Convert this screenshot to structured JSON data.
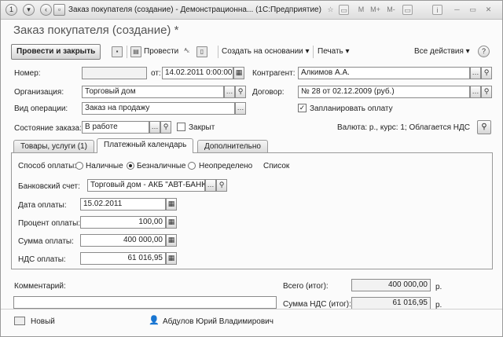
{
  "window": {
    "title": "Заказ покупателя (создание) - Демонстрационна... (1С:Предприятие)",
    "controls": [
      "☆",
      "▭",
      "M",
      "M+",
      "M-",
      "▭",
      "i",
      "─",
      "▭",
      "✕"
    ]
  },
  "form": {
    "heading": "Заказ покупателя (создание) *"
  },
  "toolbar": {
    "post_close": "Провести и закрыть",
    "post": "Провести",
    "create_based": "Создать на основании",
    "print": "Печать",
    "all_actions": "Все действия",
    "help": "?"
  },
  "fields": {
    "number_label": "Номер:",
    "number_value": "",
    "date_from_label": "от:",
    "date_value": "14.02.2011  0:00:00",
    "counterparty_label": "Контрагент:",
    "counterparty_value": "Алкимов А.А.",
    "organization_label": "Организация:",
    "organization_value": "Торговый дом",
    "contract_label": "Договор:",
    "contract_value": "№ 28 от 02.12.2009 (руб.)",
    "operation_label": "Вид операции:",
    "operation_value": "Заказ на продажу",
    "plan_payment_label": "Запланировать оплату",
    "plan_payment_checked": true,
    "order_state_label": "Состояние заказа:",
    "order_state_value": "В работе",
    "closed_label": "Закрыт",
    "closed_checked": false,
    "currency_info": "Валюта: р., курс: 1; Облагается НДС"
  },
  "tabs": [
    {
      "label": "Товары, услуги (1)"
    },
    {
      "label": "Платежный календарь"
    },
    {
      "label": "Дополнительно"
    }
  ],
  "payment": {
    "method_label": "Способ оплаты:",
    "options": [
      "Наличные",
      "Безналичные",
      "Неопределено"
    ],
    "selected": "Безналичные",
    "list_link": "Список",
    "bank_account_label": "Банковский счет:",
    "bank_account_value": "Торговый дом - АКБ \"АВТ-БАНК\"",
    "date_label": "Дата оплаты:",
    "date_value": "15.02.2011",
    "percent_label": "Процент оплаты:",
    "percent_value": "100,00",
    "amount_label": "Сумма оплаты:",
    "amount_value": "400 000,00",
    "vat_label": "НДС оплаты:",
    "vat_value": "61 016,95"
  },
  "footer": {
    "comment_label": "Комментарий:",
    "comment_value": "",
    "total_label": "Всего (итог):",
    "total_value": "400 000,00",
    "total_unit": "р.",
    "vat_total_label": "Сумма НДС (итог):",
    "vat_total_value": "61 016,95",
    "vat_total_unit": "р.",
    "status": "Новый",
    "user": "Абдулов Юрий Владимирович"
  }
}
